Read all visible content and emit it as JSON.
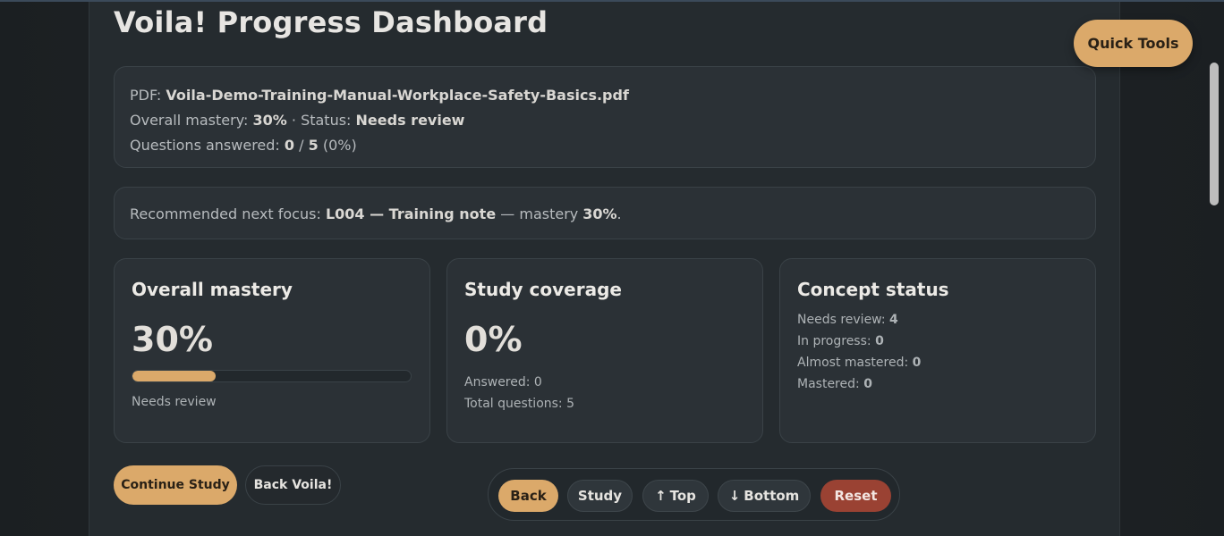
{
  "page": {
    "title": "Voila! Progress Dashboard"
  },
  "info": {
    "pdf_label": "PDF:",
    "pdf_name": "Voila-Demo-Training-Manual-Workplace-Safety-Basics.pdf",
    "mastery_label": "Overall mastery:",
    "mastery_value": "30%",
    "separator": "·",
    "status_label": "Status:",
    "status_value": "Needs review",
    "answered_label": "Questions answered:",
    "answered_count": "0",
    "answered_sep": "/",
    "total_count": "5",
    "answered_pct": "(0%)"
  },
  "focus": {
    "prefix": "Recommended next focus:",
    "concept": "L004 — Training note",
    "mid": "— mastery",
    "mastery": "30%",
    "suffix": "."
  },
  "cards": {
    "mastery": {
      "heading": "Overall mastery",
      "value": "30%",
      "progress_fraction": 0.3,
      "status": "Needs review"
    },
    "coverage": {
      "heading": "Study coverage",
      "value": "0%",
      "answered": "Answered: 0",
      "total": "Total questions: 5"
    },
    "concepts": {
      "heading": "Concept status",
      "items": [
        {
          "label": "Needs review:",
          "value": "4"
        },
        {
          "label": "In progress:",
          "value": "0"
        },
        {
          "label": "Almost mastered:",
          "value": "0"
        },
        {
          "label": "Mastered:",
          "value": "0"
        }
      ]
    }
  },
  "actions": {
    "continue_label": "Continue Study",
    "back_voila_label": "Back Voila!"
  },
  "nav": {
    "back": "Back",
    "study": "Study",
    "top_glyph": "↑",
    "top": "Top",
    "bottom_glyph": "↓",
    "bottom": "Bottom",
    "reset": "Reset"
  },
  "quick_tools": {
    "label": "Quick Tools"
  },
  "icons": {
    "top": "arrow-up-icon",
    "bottom": "arrow-down-icon"
  },
  "colors": {
    "accent": "#dba96a",
    "danger": "#9a4233",
    "panel": "#252b2f",
    "card": "#2b3136"
  }
}
